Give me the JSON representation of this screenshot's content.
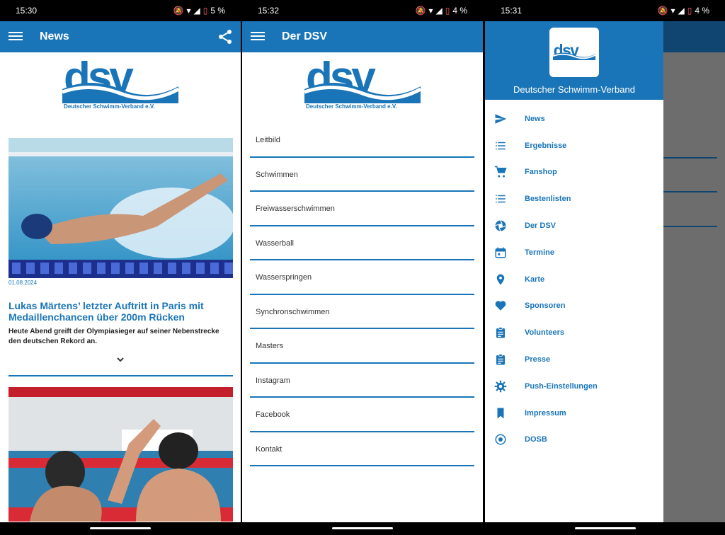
{
  "panels": [
    {
      "status": {
        "time": "15:30",
        "battery": "5 %"
      },
      "appbar": {
        "title": "News",
        "menu_icon": "hamburger-menu-icon",
        "share_icon": "share-icon"
      },
      "logo": {
        "tagline": "Deutscher Schwimm-Verband e.V."
      },
      "article": {
        "date": "01.08.2024",
        "title": "Lukas Märtens’ letzter Auftritt in Paris mit Medaillenchancen über 200m Rücken",
        "teaser": "Heute Abend greift der Olympiasieger auf seiner Nebenstrecke den deutschen Rekord an."
      }
    },
    {
      "status": {
        "time": "15:32",
        "battery": "4 %"
      },
      "appbar": {
        "title": "Der DSV",
        "menu_icon": "hamburger-menu-icon"
      },
      "logo": {
        "tagline": "Deutscher Schwimm-Verband e.V."
      },
      "items": [
        "Leitbild",
        "Schwimmen",
        "Freiwasserschwimmen",
        "Wasserball",
        "Wasserspringen",
        "Synchronschwimmen",
        "Masters",
        "Instagram",
        "Facebook",
        "Kontakt"
      ]
    },
    {
      "status": {
        "time": "15:31",
        "battery": "4 %"
      },
      "drawer": {
        "title": "Deutscher Schwimm-Verband",
        "items": [
          {
            "label": "News",
            "icon": "send-icon"
          },
          {
            "label": "Ergebnisse",
            "icon": "list-icon"
          },
          {
            "label": "Fanshop",
            "icon": "cart-icon"
          },
          {
            "label": "Bestenlisten",
            "icon": "list-icon"
          },
          {
            "label": "Der DSV",
            "icon": "shutter-icon"
          },
          {
            "label": "Termine",
            "icon": "calendar-icon"
          },
          {
            "label": "Karte",
            "icon": "map-pin-icon"
          },
          {
            "label": "Sponsoren",
            "icon": "heart-icon"
          },
          {
            "label": "Volunteers",
            "icon": "clipboard-icon"
          },
          {
            "label": "Presse",
            "icon": "clipboard-icon"
          },
          {
            "label": "Push-Einstellungen",
            "icon": "gear-icon"
          },
          {
            "label": "Impressum",
            "icon": "bookmark-icon"
          },
          {
            "label": "DOSB",
            "icon": "radio-icon"
          }
        ]
      }
    }
  ],
  "colors": {
    "brand": "#1a75b8",
    "brand_dark": "#0f4570",
    "scrim": "#6d6d6d"
  }
}
